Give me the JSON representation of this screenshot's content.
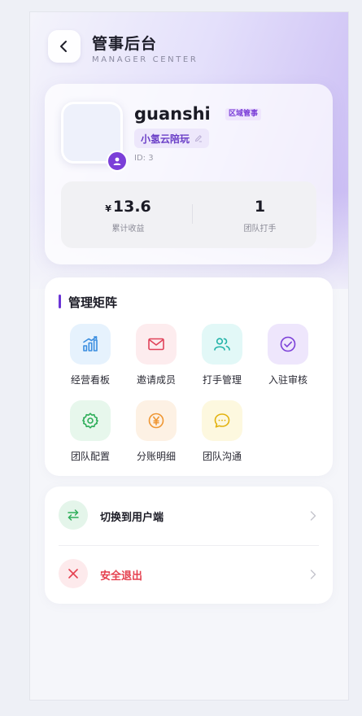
{
  "header": {
    "title": "管事后台",
    "subtitle": "MANAGER CENTER"
  },
  "profile": {
    "username": "guanshi",
    "role_badge": "区域管事",
    "team_name": "小氢云陪玩",
    "user_id": "ID: 3",
    "stats": [
      {
        "currency": "¥",
        "value": "13.6",
        "label": "累计收益"
      },
      {
        "currency": "",
        "value": "1",
        "label": "团队打手"
      }
    ]
  },
  "matrix": {
    "title": "管理矩阵",
    "items": [
      {
        "label": "经营看板",
        "icon": "bar-chart-icon",
        "bg": "#e6f2fd",
        "color": "#3b8ee0"
      },
      {
        "label": "邀请成员",
        "icon": "mail-icon",
        "bg": "#fdecee",
        "color": "#e0435a"
      },
      {
        "label": "打手管理",
        "icon": "users-icon",
        "bg": "#e2f8f7",
        "color": "#22b3a8"
      },
      {
        "label": "入驻审核",
        "icon": "check-circle-icon",
        "bg": "#eee6fc",
        "color": "#7b3fd8"
      },
      {
        "label": "团队配置",
        "icon": "gear-icon",
        "bg": "#e7f7ec",
        "color": "#2fae5a"
      },
      {
        "label": "分账明细",
        "icon": "yen-icon",
        "bg": "#fdf1e4",
        "color": "#ef9632"
      },
      {
        "label": "团队沟通",
        "icon": "chat-icon",
        "bg": "#fdf8df",
        "color": "#e2b20d"
      }
    ]
  },
  "actions": [
    {
      "label": "切换到用户端",
      "icon": "switch-icon",
      "bg": "#e4f5ea",
      "color": "#2fae5a",
      "text_color": "#1b1b25"
    },
    {
      "label": "安全退出",
      "icon": "close-icon",
      "bg": "#fdeaec",
      "color": "#e5404f",
      "text_color": "#e5404f"
    }
  ]
}
